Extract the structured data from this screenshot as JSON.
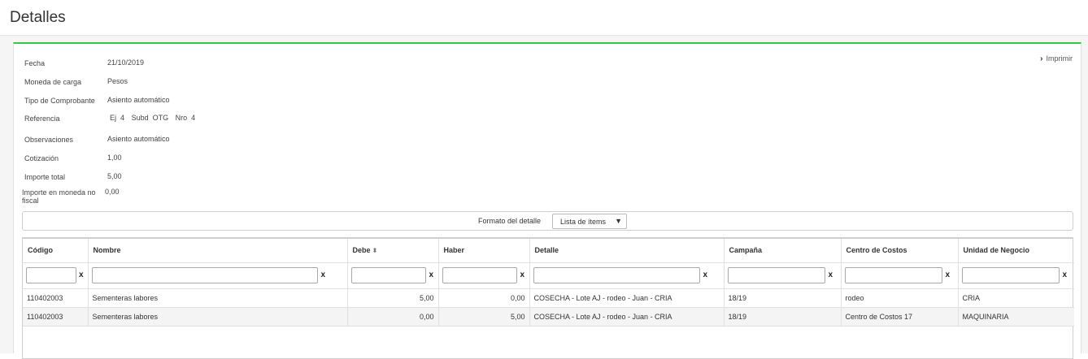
{
  "header": {
    "title": "Detalles"
  },
  "actions": {
    "print_label": "Imprimir",
    "print_icon": "chevron-right-icon"
  },
  "fields": {
    "fecha": {
      "label": "Fecha",
      "value": "21/10/2019"
    },
    "moneda": {
      "label": "Moneda de carga",
      "value": "Pesos"
    },
    "tipo": {
      "label": "Tipo de Comprobante",
      "value": "Asiento automático"
    },
    "referencia": {
      "label": "Referencia",
      "ej_label": "Ej",
      "ej_value": "4",
      "subd_label": "Subd",
      "subd_value": "OTG",
      "nro_label": "Nro",
      "nro_value": "4"
    },
    "observaciones": {
      "label": "Observaciones",
      "value": "Asiento automático"
    },
    "cotizacion": {
      "label": "Cotización",
      "value": "1,00"
    },
    "importe_total": {
      "label": "Importe total",
      "value": "5,00"
    },
    "importe_no_fiscal": {
      "label": "Importe en moneda no fiscal",
      "value": "0,00"
    }
  },
  "format": {
    "label": "Formato del detalle",
    "selected": "Lista de ítems"
  },
  "table": {
    "columns": {
      "codigo": "Código",
      "nombre": "Nombre",
      "debe": "Debe",
      "haber": "Haber",
      "detalle": "Detalle",
      "campana": "Campaña",
      "centro": "Centro de Costos",
      "unidad": "Unidad de Negocio"
    },
    "filter_clear": "x",
    "rows": [
      {
        "codigo": "110402003",
        "nombre": "Sementeras labores",
        "debe": "5,00",
        "haber": "0,00",
        "detalle": "COSECHA - Lote AJ - rodeo - Juan - CRIA",
        "campana": "18/19",
        "centro": "rodeo",
        "unidad": "CRIA"
      },
      {
        "codigo": "110402003",
        "nombre": "Sementeras labores",
        "debe": "0,00",
        "haber": "5,00",
        "detalle": "COSECHA - Lote AJ - rodeo - Juan - CRIA",
        "campana": "18/19",
        "centro": "Centro de Costos 17",
        "unidad": "MAQUINARIA"
      }
    ]
  }
}
